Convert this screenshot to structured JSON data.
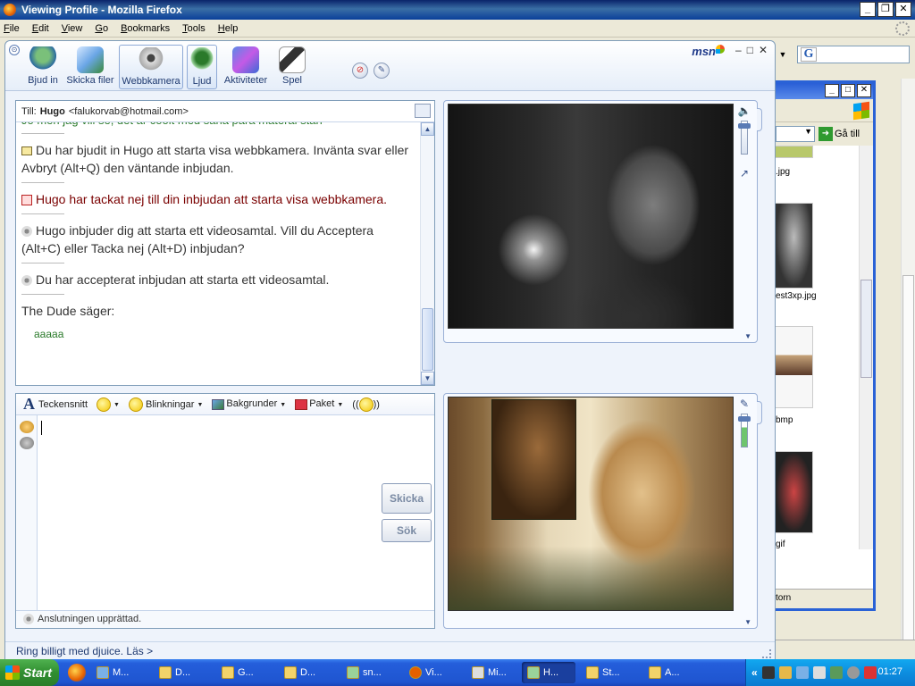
{
  "firefox": {
    "title": "Viewing Profile - Mozilla Firefox",
    "menu": [
      "File",
      "Edit",
      "View",
      "Go",
      "Bookmarks",
      "Tools",
      "Help"
    ],
    "search_engine_glyph": "G"
  },
  "explorer": {
    "go_label": "Gå till",
    "files": [
      ".jpg",
      "est3xp.jpg",
      "bmp",
      "gif"
    ],
    "status": "torn"
  },
  "msn": {
    "toolbar": [
      {
        "label": "Bjud in",
        "icon": "invite-icon"
      },
      {
        "label": "Skicka filer",
        "icon": "send-files-icon"
      },
      {
        "label": "Webbkamera",
        "icon": "webcam-icon",
        "active": true
      },
      {
        "label": "Ljud",
        "icon": "audio-icon",
        "active": true
      },
      {
        "label": "Aktiviteter",
        "icon": "activities-icon"
      },
      {
        "label": "Spel",
        "icon": "games-icon"
      }
    ],
    "logo": "msn",
    "to_label": "Till:",
    "contact_name": "Hugo",
    "contact_email": "<falukorvab@hotmail.com>",
    "conversation": {
      "cropped_line": "Jo men jag vill se, det är coolt med säna para materal stan",
      "messages": [
        {
          "text": "Du har bjudit in Hugo att starta visa webbkamera. Invänta svar eller Avbryt (Alt+Q) den väntande inbjudan.",
          "style": "normal",
          "icon": "mail-icon"
        },
        {
          "text": "Hugo har tackat nej till din inbjudan att starta visa webbkamera.",
          "style": "red",
          "icon": "declined-icon"
        },
        {
          "text": "Hugo inbjuder dig att starta ett videosamtal. Vill du Acceptera (Alt+C) eller Tacka nej (Alt+D) inbjudan?",
          "style": "normal",
          "icon": "webcam-small-icon"
        },
        {
          "text": "Du har accepterat inbjudan att starta ett videosamtal.",
          "style": "normal",
          "icon": "webcam-small-icon"
        }
      ],
      "sender_line": "The Dude säger:",
      "last_message": "aaaaa"
    },
    "compose": {
      "font_label": "Teckensnitt",
      "wink_label": "Blinkningar",
      "background_label": "Bakgrunder",
      "pack_label": "Paket",
      "send_label": "Skicka",
      "search_label": "Sök",
      "input_value": "",
      "status": "Anslutningen upprättad."
    },
    "ad": "Ring billigt med djuice. Läs >"
  },
  "taskbar": {
    "start": "Start",
    "tasks": [
      {
        "label": "M..."
      },
      {
        "label": "D..."
      },
      {
        "label": "G..."
      },
      {
        "label": "D..."
      },
      {
        "label": "sn..."
      },
      {
        "label": "Vi..."
      },
      {
        "label": "Mi..."
      },
      {
        "label": "H...",
        "active": true
      },
      {
        "label": "St..."
      },
      {
        "label": "A..."
      }
    ],
    "clock": "01:27"
  }
}
